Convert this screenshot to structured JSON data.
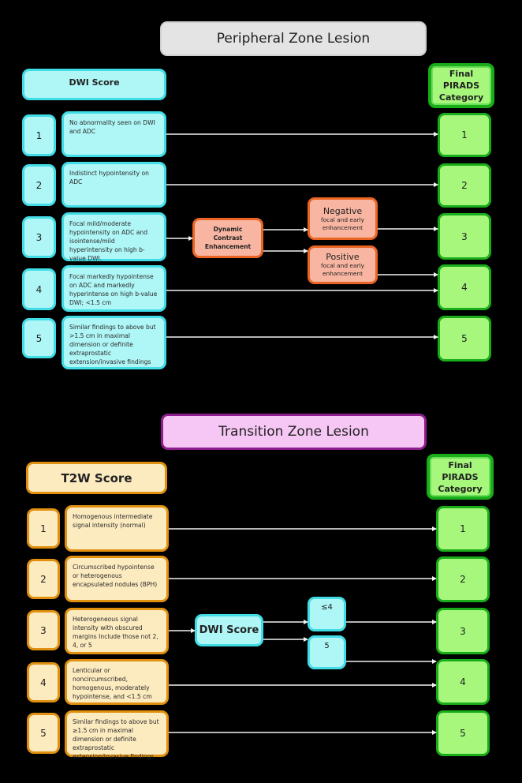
{
  "peripheral": {
    "title": "Peripheral Zone Lesion",
    "score_header": "DWI Score",
    "final_header": "Final PIRADS Category",
    "rows": [
      {
        "score": "1",
        "description": "No abnormality seen on DWI and ADC",
        "final": "1"
      },
      {
        "score": "2",
        "description": "Indistinct hypointensity on ADC",
        "final": "2"
      },
      {
        "score": "3",
        "description": "Focal mild/moderate hypointensity on ADC and isointense/mild hyperintensity on high b-value DWI.",
        "final": "3"
      },
      {
        "score": "4",
        "description": "Focal markedly hypointense on ADC and markedly hyperintense on high b-value DWI; <1.5 cm",
        "final": "4"
      },
      {
        "score": "5",
        "description": "Similar findings to above but >1.5 cm in maximal dimension or definite extraprostatic extension/invasive findings",
        "final": "5"
      }
    ],
    "branch": {
      "label": "Dynamic Contrast Enhancement",
      "negative": {
        "title": "Negative",
        "subtitle": "focal and early enhancement"
      },
      "positive": {
        "title": "Positive",
        "subtitle": "focal and early enhancement"
      }
    },
    "colors": {
      "score": "#aff6f6",
      "branch": "#f8b5a1",
      "final": "#a6f77c"
    }
  },
  "transition": {
    "title": "Transition Zone Lesion",
    "score_header": "T2W Score",
    "final_header": "Final PIRADS Category",
    "rows": [
      {
        "score": "1",
        "description": "Homogenous intermediate signal intensity (normal)",
        "final": "1"
      },
      {
        "score": "2",
        "description": "Circumscribed hypointense or heterogenous encapsulated nodules (BPH)",
        "final": "2"
      },
      {
        "score": "3",
        "description": "Heterogeneous signal intensity with obscured margins Include those not 2, 4, or 5",
        "final": "3"
      },
      {
        "score": "4",
        "description": "Lenticular or noncircumscribed, homogenous, moderately hypointense, and <1.5 cm",
        "final": "4"
      },
      {
        "score": "5",
        "description": "Similar findings to above but ≥1.5 cm in maximal dimension or definite extraprostatic extension/invasive findings",
        "final": "5"
      }
    ],
    "branch": {
      "label": "DWI Score",
      "low": "≤4",
      "high": "5"
    },
    "colors": {
      "score": "#fdebc0",
      "branch": "#aff6f6",
      "final": "#a6f77c"
    }
  }
}
